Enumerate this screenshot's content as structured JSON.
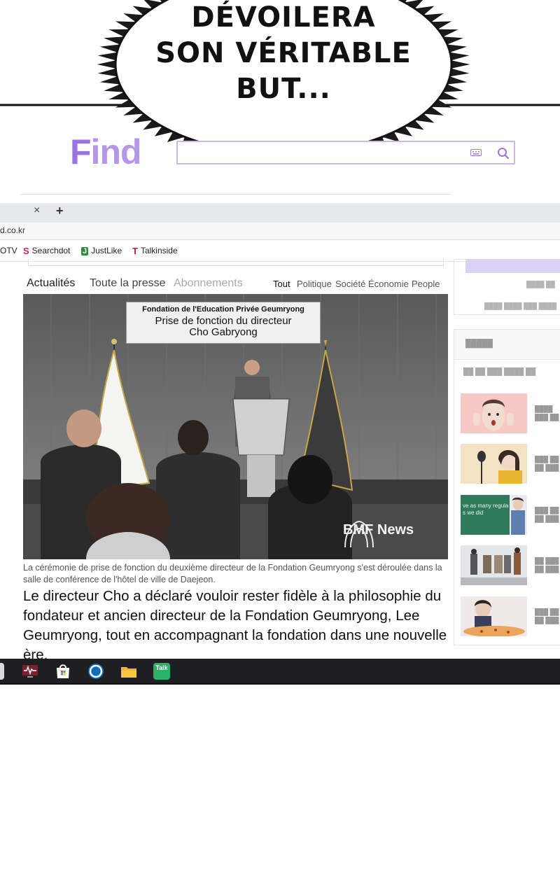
{
  "bubble": {
    "lines": [
      "DÉVOILERA",
      "SON VÉRITABLE",
      "BUT..."
    ]
  },
  "find": {
    "logo": "Find",
    "logo_first": "F",
    "logo_rest": "ind"
  },
  "browser": {
    "tab_close": "×",
    "tab_new": "+",
    "url": "d.co.kr",
    "bookmarks": [
      {
        "label": "OTV"
      },
      {
        "label": "Searchdot",
        "icon": "S"
      },
      {
        "label": "JustLike",
        "icon": "J"
      },
      {
        "label": "Talkinside",
        "icon": "T"
      }
    ]
  },
  "nav": {
    "main": [
      "Actualités",
      "Toute la presse",
      "Abonnements"
    ],
    "categories": [
      "Tout",
      "Politique",
      "Société",
      "Économie",
      "People"
    ]
  },
  "article": {
    "sign": {
      "line1": "Fondation de l'Education Privée Geumryong",
      "line2": "Prise de fonction du directeur",
      "line3": "Cho Gabryong"
    },
    "watermark": "BMF News",
    "caption": "La cérémonie de prise de fonction du deuxième directeur de la Fondation Geumryong s'est déroulée dans la salle de conférence de l'hôtel de ville de Daejeon.",
    "body": "Le directeur Cho a déclaré vouloir rester fidèle à la philosophie du fondateur et ancien directeur de la Fondation Geumryong, Lee Geumryong, tout en accompagnant la fondation dans une nouvelle ère."
  },
  "sidebar": {
    "thumb3_text": "ve as many regula\ns we did"
  },
  "taskbar": {
    "talk_label": "Talk"
  },
  "colors": {
    "find_purple": "#9a74e3",
    "taskbar": "#1f1f23",
    "sidebar_button": "#dcd2f6"
  }
}
